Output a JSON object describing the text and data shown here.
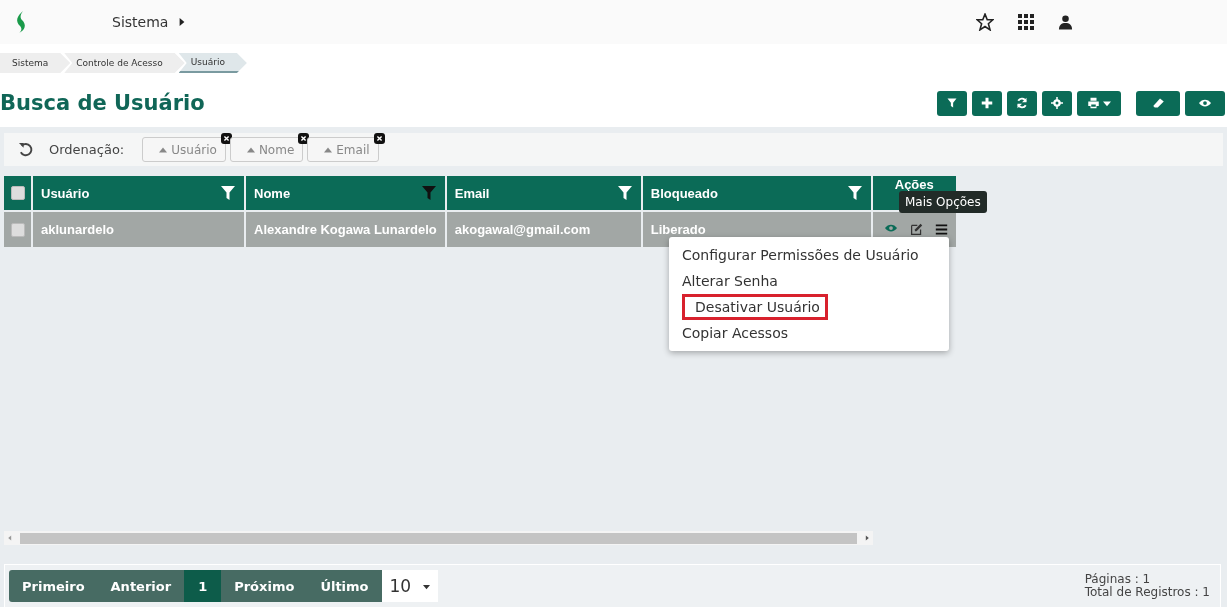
{
  "topbar": {
    "menu": "Sistema"
  },
  "breadcrumb": [
    {
      "label": "Sistema",
      "selected": false
    },
    {
      "label": "Controle de Acesso",
      "selected": false
    },
    {
      "label": "Usuário",
      "selected": true
    }
  ],
  "page_title": "Busca de Usuário",
  "sort_bar": {
    "label": "Ordenação:",
    "chips": [
      "Usuário",
      "Nome",
      "Email"
    ]
  },
  "table": {
    "columns": [
      {
        "label": "Usuário",
        "filter_active": false
      },
      {
        "label": "Nome",
        "filter_active": true
      },
      {
        "label": "Email",
        "filter_active": false
      },
      {
        "label": "Bloqueado",
        "filter_active": false
      },
      {
        "label": "Ações"
      }
    ],
    "select_all_checked": false,
    "rows": [
      {
        "checked": false,
        "selected": true,
        "cells": [
          "aklunardelo",
          "Alexandre Kogawa Lunardelo",
          "akogawal@gmail.com",
          "Liberado"
        ]
      }
    ]
  },
  "tooltip": "Mais Opções",
  "menu": [
    {
      "label": "Configurar Permissões de Usuário",
      "outlined": false
    },
    {
      "label": "Alterar Senha",
      "outlined": false
    },
    {
      "label": "Desativar Usuário",
      "outlined": true
    },
    {
      "label": "Copiar Acessos",
      "outlined": false
    }
  ],
  "pagination": [
    {
      "label": "Primeiro",
      "selected": false
    },
    {
      "label": "Anterior",
      "selected": false
    },
    {
      "label": "1",
      "selected": true
    },
    {
      "label": "Próximo",
      "selected": false
    },
    {
      "label": "Último",
      "selected": false
    }
  ],
  "page_size": "10",
  "summary": [
    "Páginas : 1",
    "Total de Registros : 1"
  ]
}
